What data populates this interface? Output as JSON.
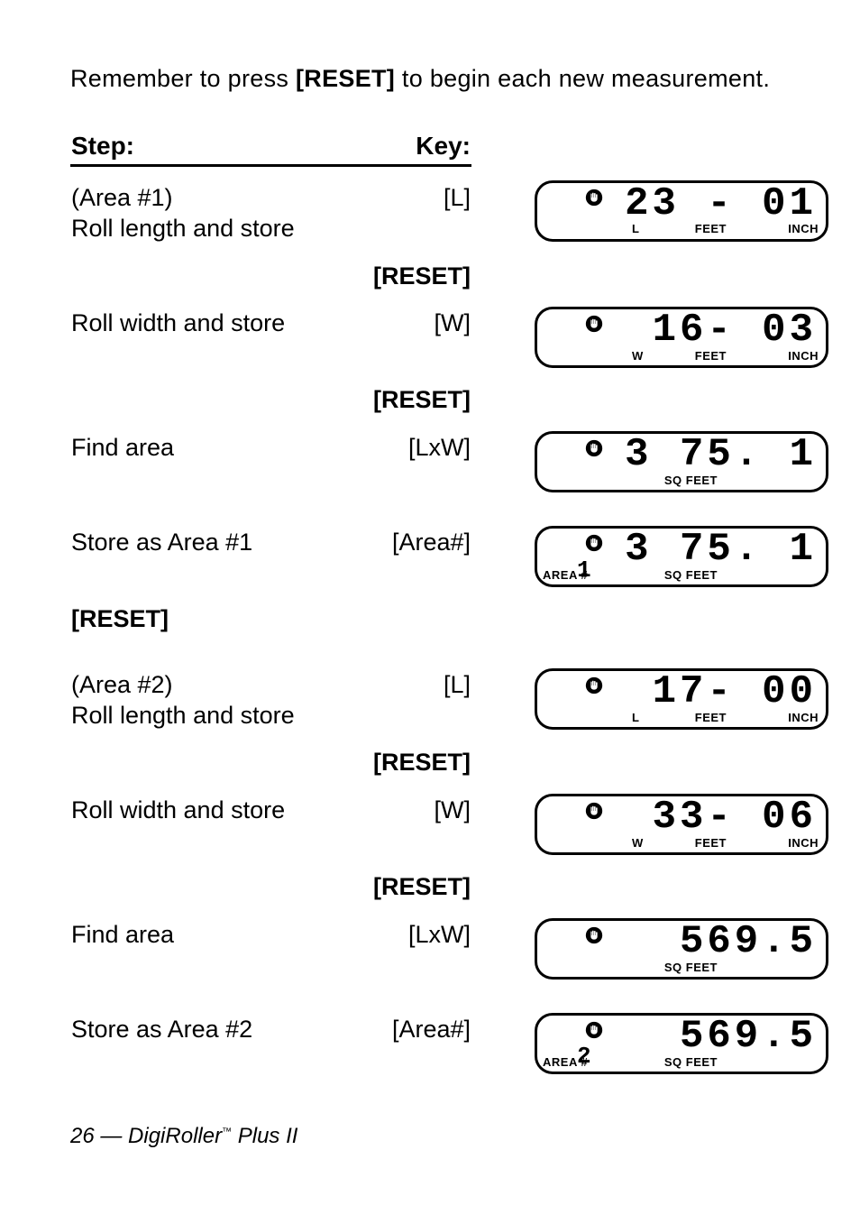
{
  "intro_pre": "Remember to press ",
  "intro_reset": "[RESET]",
  "intro_post": " to begin each new measurement.",
  "headers": {
    "step": "Step:",
    "key": "Key:"
  },
  "rows": [
    {
      "step": "(Area #1)\nRoll length and store",
      "key": "[L]",
      "lcd": {
        "digits": "23 - 01",
        "dim": "L",
        "feet": "FEET",
        "inch": "INCH"
      }
    },
    {
      "step": "",
      "key": "[RESET]",
      "bold": true
    },
    {
      "step": "Roll width and store",
      "key": "[W]",
      "lcd": {
        "digits": "16- 03",
        "dim": "W",
        "feet": "FEET",
        "inch": "INCH"
      }
    },
    {
      "step": "",
      "key": "[RESET]",
      "bold": true
    },
    {
      "step": "Find area",
      "key": "[LxW]",
      "lcd": {
        "digits": "3 75. 1",
        "sq": "SQ FEET"
      }
    },
    {
      "spacer": true
    },
    {
      "step": "Store as Area #1",
      "key": "[Area#]",
      "lcd": {
        "digits": "3 75. 1",
        "sq": "SQ FEET",
        "area_label": "AREA #",
        "area_num": "1"
      }
    },
    {
      "step": "[RESET]",
      "step_bold": true,
      "key": ""
    },
    {
      "spacer": true
    },
    {
      "step": "(Area #2)\nRoll length and store",
      "key": "[L]",
      "lcd": {
        "digits": "17- 00",
        "dim": "L",
        "feet": "FEET",
        "inch": "INCH"
      }
    },
    {
      "step": "",
      "key": "[RESET]",
      "bold": true
    },
    {
      "step": "Roll width and store",
      "key": "[W]",
      "lcd": {
        "digits": "33- 06",
        "dim": "W",
        "feet": "FEET",
        "inch": "INCH"
      }
    },
    {
      "step": "",
      "key": "[RESET]",
      "bold": true
    },
    {
      "step": "Find area",
      "key": "[LxW]",
      "lcd": {
        "digits": "569.5",
        "sq": "SQ FEET"
      }
    },
    {
      "spacer": true
    },
    {
      "step": "Store as Area #2",
      "key": "[Area#]",
      "lcd": {
        "digits": "569.5",
        "sq": "SQ FEET",
        "area_label": "AREA #",
        "area_num": "2"
      }
    }
  ],
  "footer": {
    "page": "26",
    "dash": " — ",
    "product_a": "DigiRoller",
    "tm": "™",
    "product_b": " Plus II"
  }
}
